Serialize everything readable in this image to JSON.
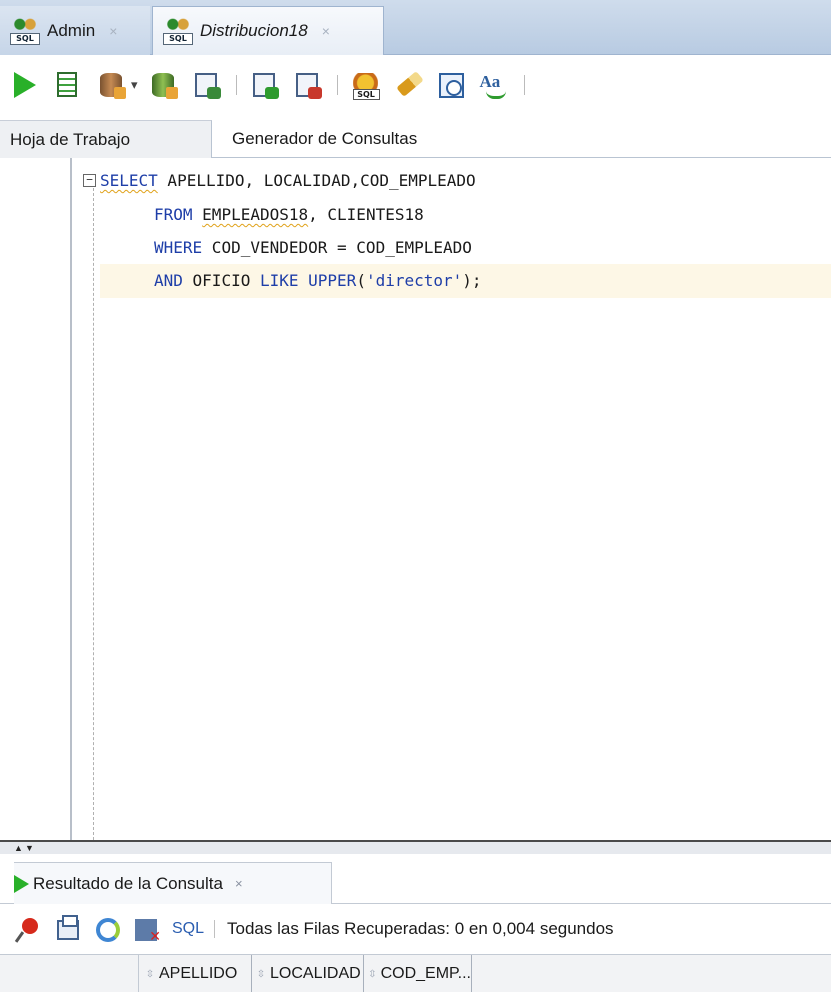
{
  "doc_tabs": [
    {
      "label": "Admin",
      "icon": "sql-connection-icon",
      "active": false,
      "close": "×"
    },
    {
      "label": "Distribucion18",
      "icon": "sql-connection-icon",
      "active": true,
      "close": "×"
    }
  ],
  "toolbar": {
    "buttons": [
      "run-statement-icon",
      "run-script-icon",
      "commit-icon",
      "dropdown-caret-icon",
      "rollback-icon",
      "explain-plan-icon",
      "autotrace-icon",
      "database-refresh-icon",
      "sql-tuning-icon",
      "clear-eraser-icon",
      "sql-history-icon",
      "format-case-icon"
    ],
    "icon_tag": "SQL",
    "format_label": "Aa"
  },
  "worksheet_tabs": [
    {
      "label": "Hoja de Trabajo",
      "active": true
    },
    {
      "label": "Generador de Consultas",
      "active": false
    }
  ],
  "editor": {
    "fold_symbol": "−",
    "lines": [
      {
        "parts": [
          {
            "text": "SELECT",
            "type": "keyword",
            "squiggle": true
          },
          {
            "text": " APELLIDO, LOCALIDAD,COD_EMPLEADO",
            "type": "identifier"
          }
        ]
      },
      {
        "parts": [
          {
            "text": "FROM",
            "type": "keyword"
          },
          {
            "text": " ",
            "type": "identifier"
          },
          {
            "text": "EMPLEADOS18",
            "type": "identifier",
            "squiggle": true
          },
          {
            "text": ", CLIENTES18",
            "type": "identifier"
          }
        ]
      },
      {
        "parts": [
          {
            "text": "WHERE",
            "type": "keyword"
          },
          {
            "text": " COD_VENDEDOR = COD_EMPLEADO",
            "type": "identifier"
          }
        ]
      },
      {
        "parts": [
          {
            "text": "AND",
            "type": "keyword"
          },
          {
            "text": " OFICIO ",
            "type": "identifier"
          },
          {
            "text": "LIKE",
            "type": "keyword"
          },
          {
            "text": " ",
            "type": "identifier"
          },
          {
            "text": "UPPER",
            "type": "keyword"
          },
          {
            "text": "(",
            "type": "identifier"
          },
          {
            "text": "'director'",
            "type": "string"
          },
          {
            "text": ");",
            "type": "identifier"
          }
        ]
      }
    ]
  },
  "results": {
    "tab_label": "Resultado de la Consulta",
    "tab_close": "×",
    "sql_link": "SQL",
    "separator": "|",
    "status": "Todas las Filas Recuperadas: 0 en 0,004 segundos",
    "columns": [
      "APELLIDO",
      "LOCALIDAD",
      "COD_EMP..."
    ]
  },
  "colors": {
    "keyword": "#1e3ea8",
    "string": "#1e3ea8",
    "run_green": "#29b029",
    "current_line": "#fdf7e6"
  }
}
